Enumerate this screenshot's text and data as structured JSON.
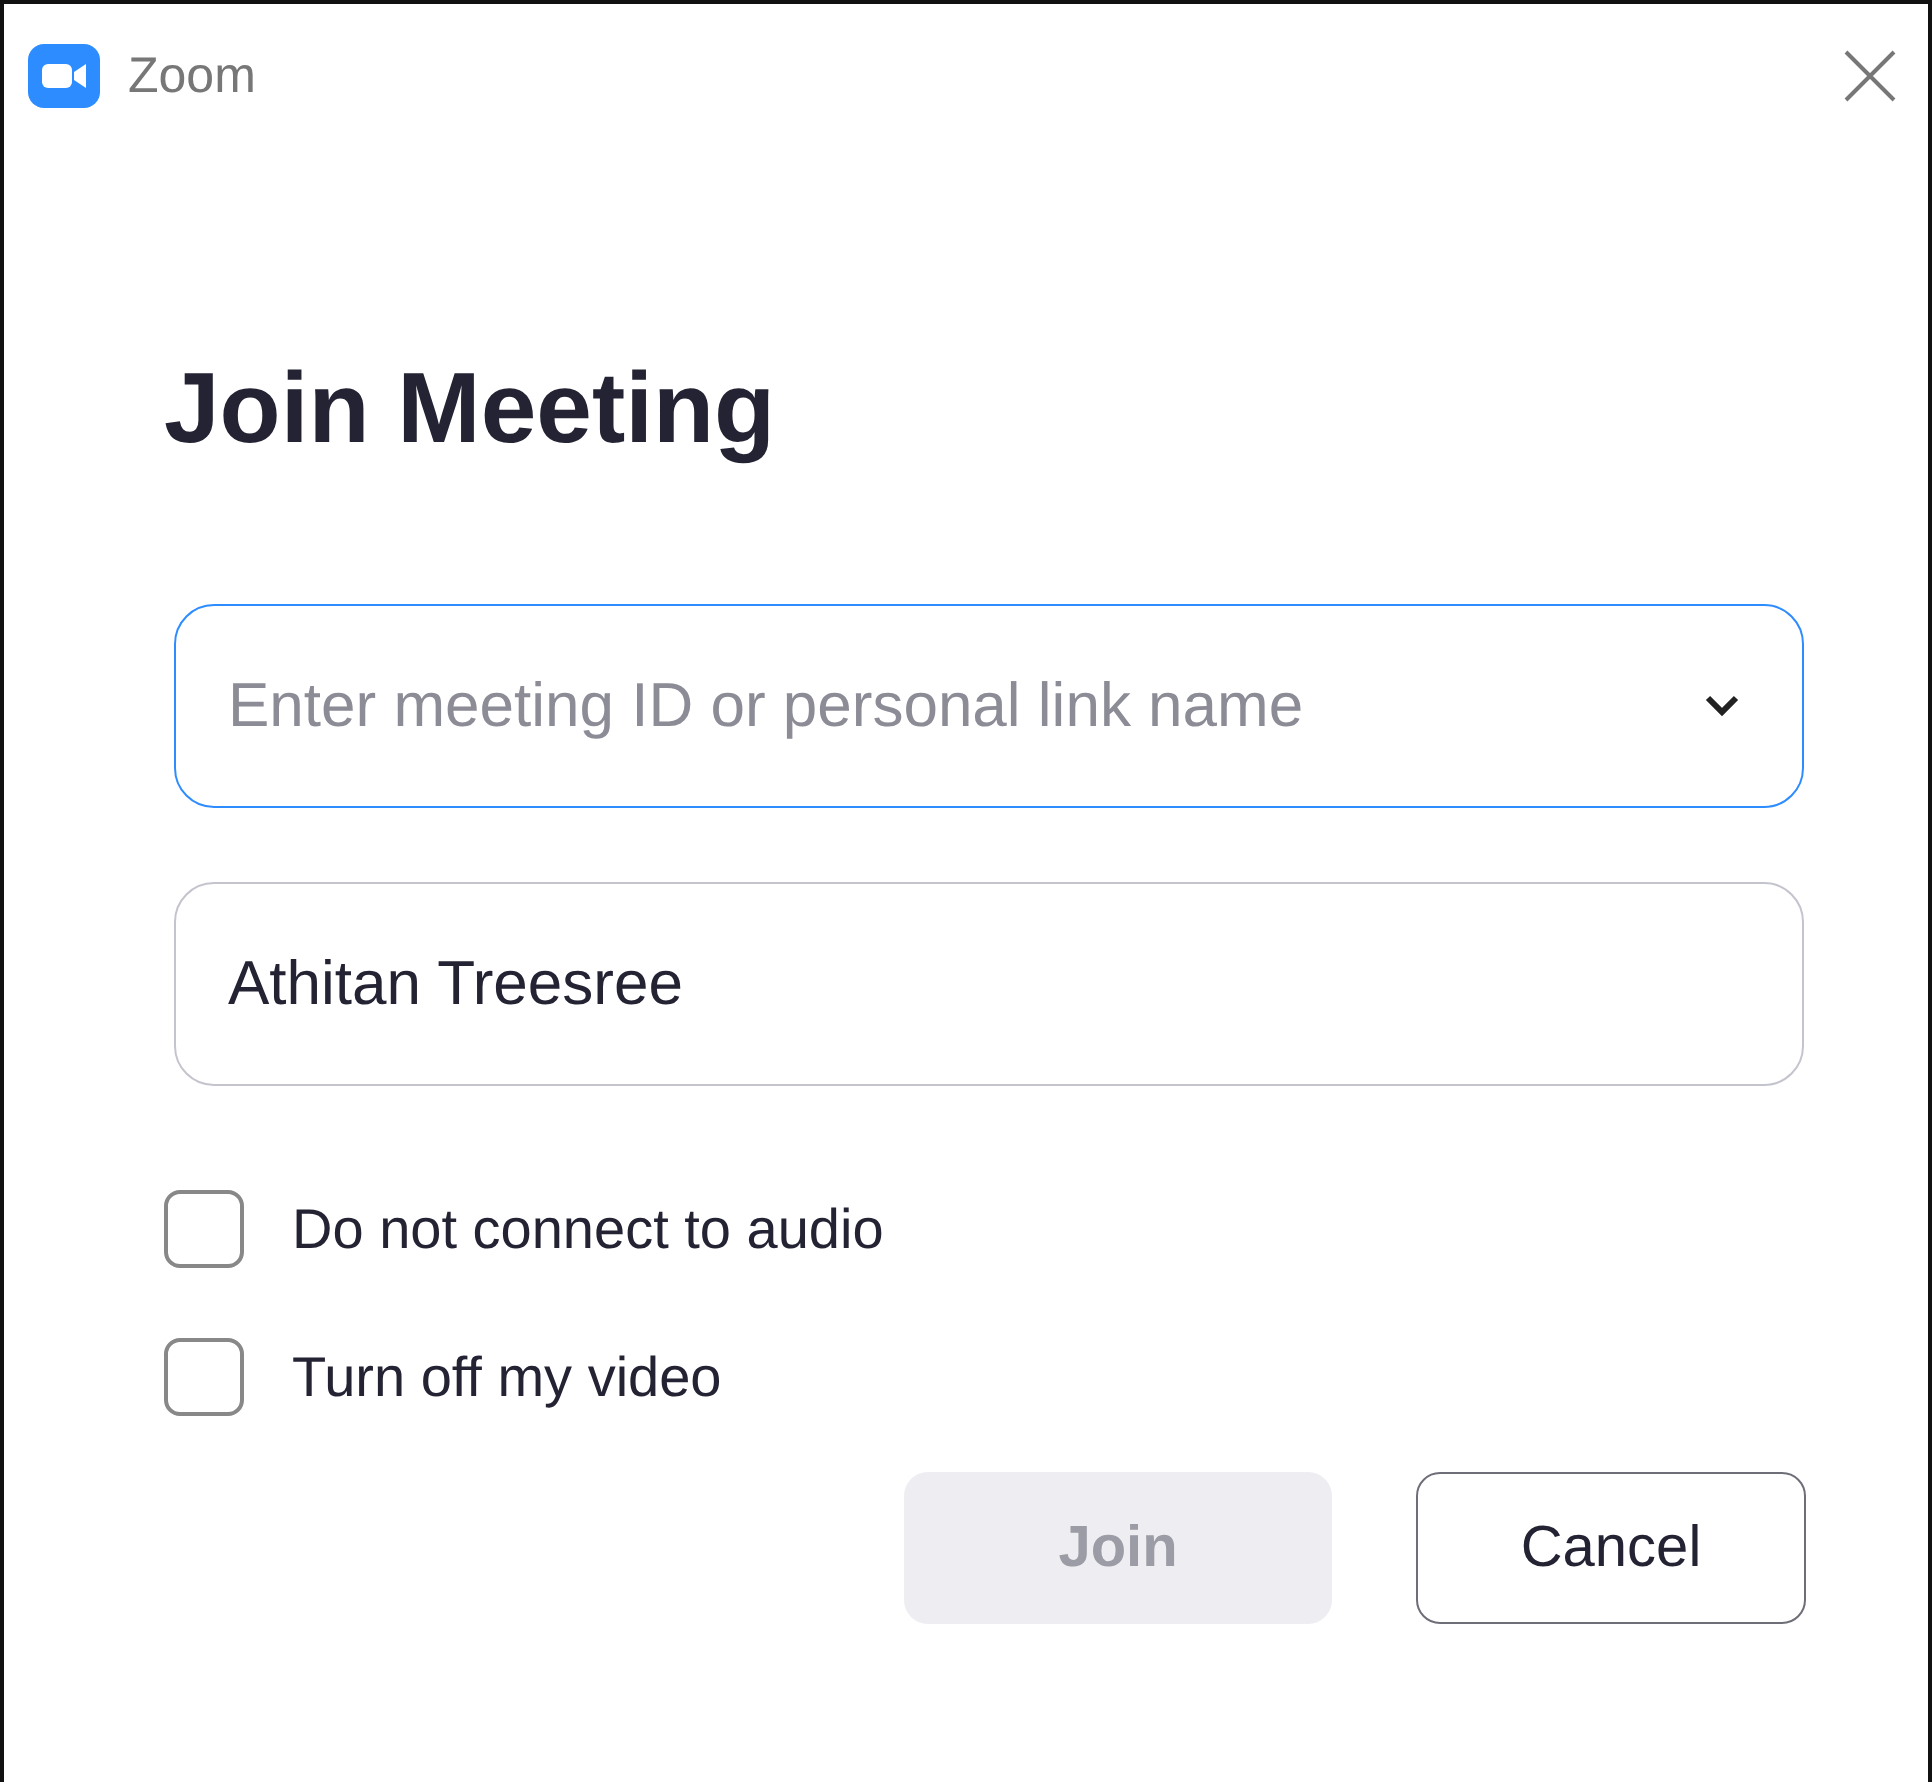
{
  "window": {
    "title": "Zoom"
  },
  "heading": "Join Meeting",
  "meeting_field": {
    "placeholder": "Enter meeting ID or personal link name",
    "focused": true
  },
  "name_field": {
    "value": "Athitan Treesree",
    "focused": false
  },
  "options": [
    {
      "label": "Do not connect to audio",
      "checked": false
    },
    {
      "label": "Turn off my video",
      "checked": false
    }
  ],
  "buttons": [
    {
      "label": "Join",
      "disabled": true
    },
    {
      "label": "Cancel",
      "disabled": false
    }
  ]
}
